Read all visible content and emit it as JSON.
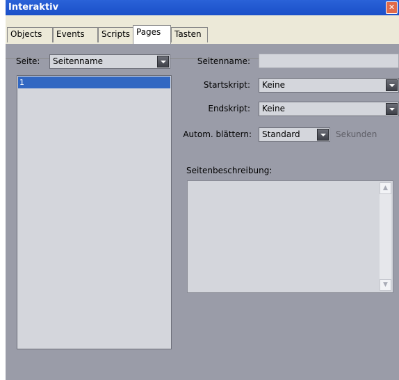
{
  "window": {
    "title": "Interaktiv",
    "close_icon": "close-icon"
  },
  "tabs": [
    {
      "label": "Objects",
      "active": false
    },
    {
      "label": "Events",
      "active": false
    },
    {
      "label": "Scripts",
      "active": false
    },
    {
      "label": "Pages",
      "active": true
    },
    {
      "label": "Tasten",
      "active": false
    }
  ],
  "left": {
    "page_label": "Seite:",
    "page_combo_value": "Seitenname",
    "list_items": [
      "1"
    ]
  },
  "right": {
    "seitenname_label": "Seitenname:",
    "seitenname_value": "",
    "startskript_label": "Startskript:",
    "startskript_value": "Keine",
    "endskript_label": "Endskript:",
    "endskript_value": "Keine",
    "auto_label": "Autom. blättern:",
    "auto_value": "Standard",
    "seconds_label": "Sekunden",
    "description_label": "Seitenbeschreibung:",
    "description_value": ""
  },
  "colors": {
    "panel_bg": "#9a9ca8",
    "titlebar": "#1a4fc8",
    "selection": "#3167c2",
    "field_bg": "#d4d6dc"
  }
}
